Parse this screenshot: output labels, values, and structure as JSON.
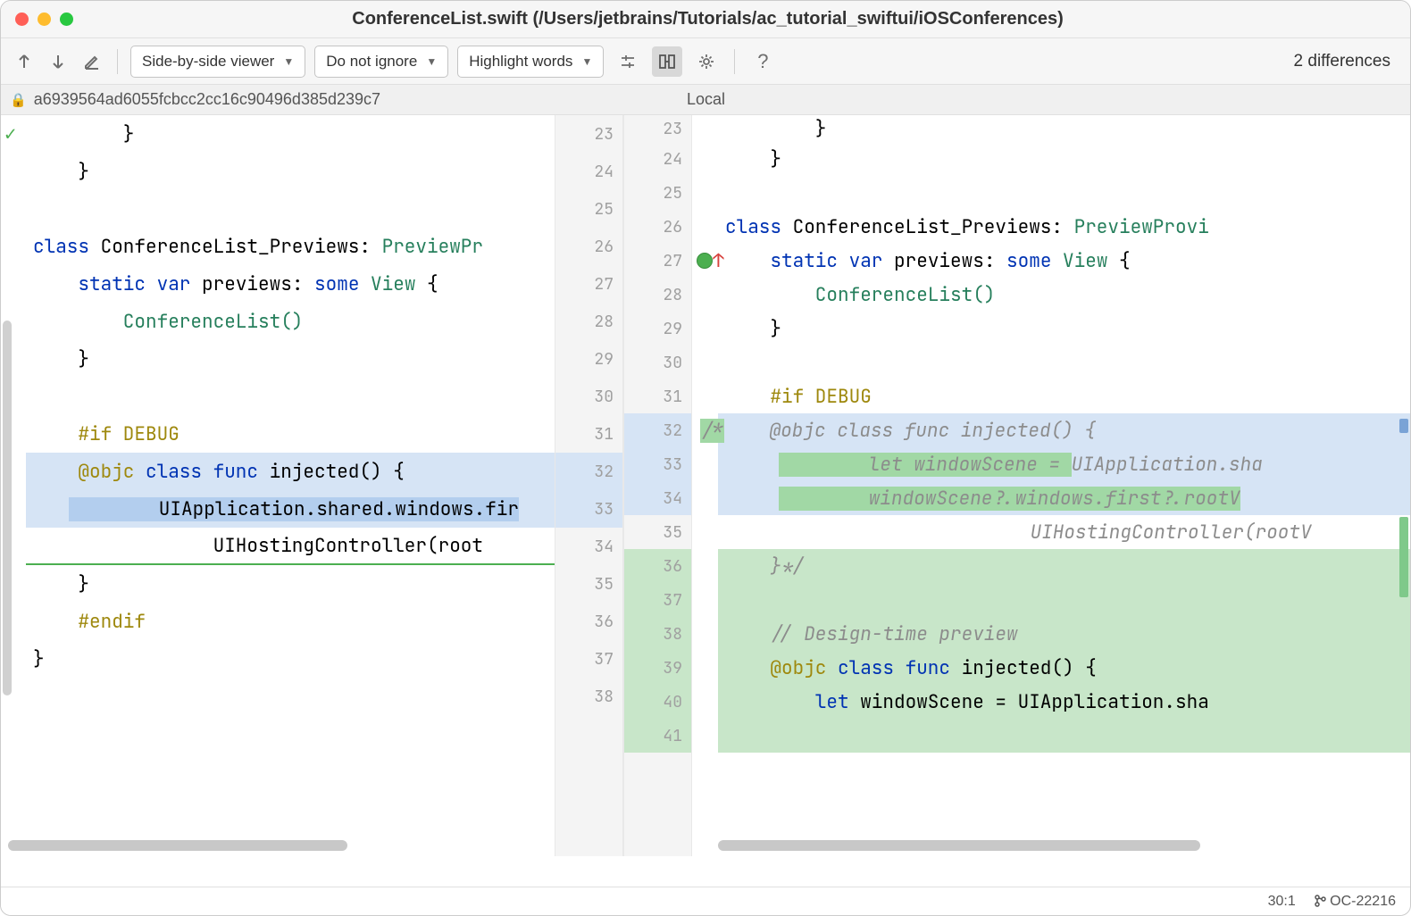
{
  "window": {
    "title": "ConferenceList.swift (/Users/jetbrains/Tutorials/ac_tutorial_swiftui/iOSConferences)"
  },
  "toolbar": {
    "viewer_mode": "Side-by-side viewer",
    "ignore_mode": "Do not ignore",
    "highlight_mode": "Highlight words",
    "diff_count": "2 differences"
  },
  "labels": {
    "left_revision": "a6939564ad6055fcbcc2cc16c90496d385d239c7",
    "right_revision": "Local"
  },
  "left_lines": [
    23,
    24,
    25,
    26,
    27,
    28,
    29,
    30,
    31,
    32,
    33,
    34,
    35,
    36,
    37,
    38
  ],
  "right_lines": [
    23,
    24,
    25,
    26,
    27,
    28,
    29,
    30,
    31,
    32,
    33,
    34,
    35,
    36,
    37,
    38,
    39,
    40,
    41
  ],
  "left_code": {
    "l23": "        }",
    "l24": "    }",
    "l26_class": "class",
    "l26_name": " ConferenceList_Previews: ",
    "l26_ty": "PreviewPr",
    "l27_kw1": "    static ",
    "l27_kw2": "var",
    "l27_id": " previews: ",
    "l27_kw3": "some ",
    "l27_ty": "View",
    "l27_rest": " {",
    "l28": "        ConferenceList()",
    "l29": "    }",
    "l31": "    #if DEBUG",
    "l32_att": "    @objc ",
    "l32_kw": "class func",
    "l32_rest": " injected() {",
    "l33": "        UIApplication.shared.windows.fir",
    "l34": "                UIHostingController(root",
    "l35": "    }",
    "l36": "    #endif",
    "l37": "}"
  },
  "right_code": {
    "l23": "        }",
    "l24": "    }",
    "l26_class": "class",
    "l26_name": " ConferenceList_Previews: ",
    "l26_ty": "PreviewProvi",
    "l27_kw1": "    static ",
    "l27_kw2": "var",
    "l27_id": " previews: ",
    "l27_kw3": "some ",
    "l27_ty": "View",
    "l27_rest": " {",
    "l28": "        ConferenceList()",
    "l29": "    }",
    "l31": "    #if DEBUG",
    "l32_open": "/*",
    "l32": "    @objc class func injected() {",
    "l33a": "        let windowScene = ",
    "l33b": "UIApplication.sha",
    "l34": "        windowScene?.windows.first?.rootV",
    "l35": "                UIHostingController(rootV",
    "l36": "    }*/",
    "l38": "    // Design-time preview",
    "l39_att": "    @objc ",
    "l39_kw": "class func",
    "l39_rest": " injected() {",
    "l40_kw": "        let",
    "l40_rest": " windowScene = UIApplication.sha"
  },
  "status": {
    "pos": "30:1",
    "branch": "OC-22216"
  }
}
